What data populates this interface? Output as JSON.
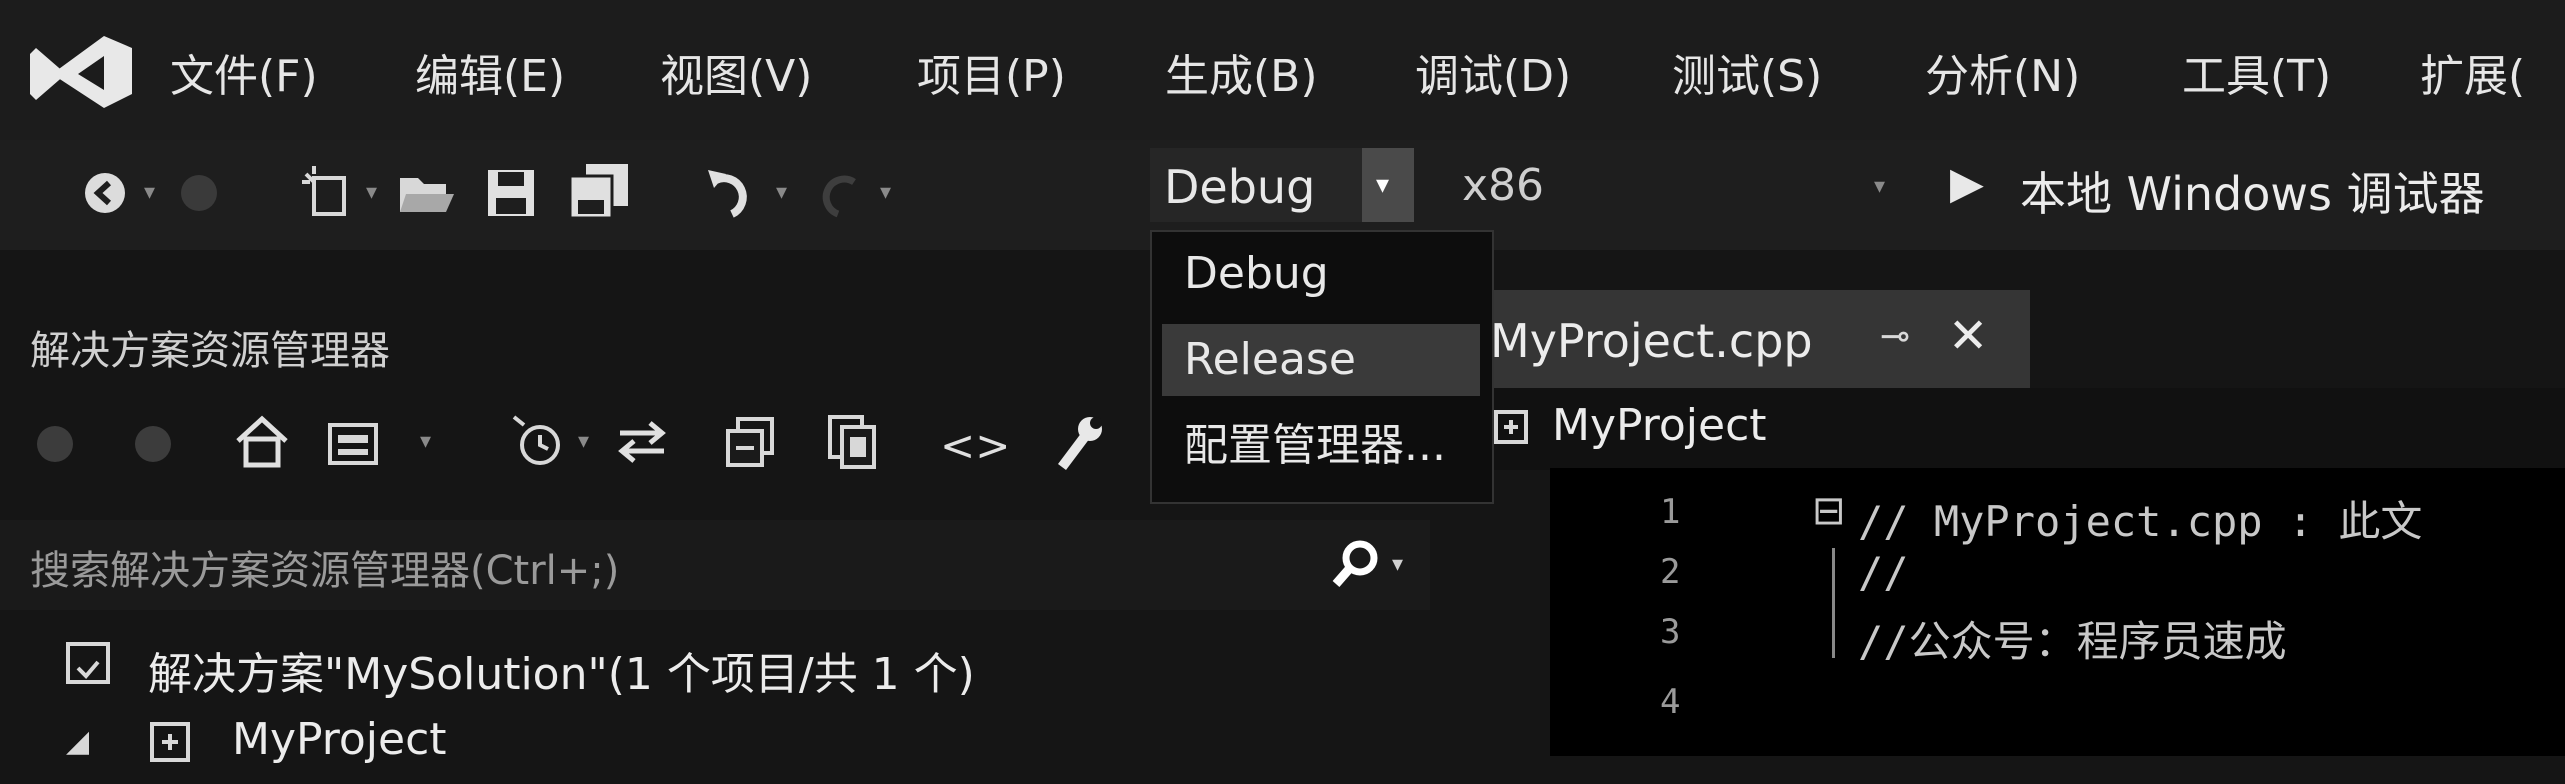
{
  "menu": {
    "items": [
      {
        "label": "文件(F)"
      },
      {
        "label": "编辑(E)"
      },
      {
        "label": "视图(V)"
      },
      {
        "label": "项目(P)"
      },
      {
        "label": "生成(B)"
      },
      {
        "label": "调试(D)"
      },
      {
        "label": "测试(S)"
      },
      {
        "label": "分析(N)"
      },
      {
        "label": "工具(T)"
      },
      {
        "label": "扩展("
      }
    ]
  },
  "toolbar": {
    "config_value": "Debug",
    "platform_value": "x86",
    "run_label": "本地 Windows 调试器"
  },
  "config_dropdown": {
    "options": [
      {
        "label": "Debug"
      },
      {
        "label": "Release"
      },
      {
        "label": "配置管理器..."
      }
    ]
  },
  "solution_explorer": {
    "title": "解决方案资源管理器",
    "search_placeholder": "搜索解决方案资源管理器(Ctrl+;)",
    "solution_label": "解决方案\"MySolution\"(1 个项目/共 1 个)",
    "project_label": "MyProject"
  },
  "editor": {
    "tab_label": "MyProject.cpp",
    "nav_scope": "MyProject",
    "lines": [
      {
        "num": "1",
        "text": "// MyProject.cpp : 此文"
      },
      {
        "num": "2",
        "text": "//"
      },
      {
        "num": "3",
        "text": "//公众号：程序员速成"
      },
      {
        "num": "4",
        "text": ""
      }
    ]
  },
  "colors": {
    "vs_logo": "#e8e8e8",
    "background": "#151515",
    "selection_highlight": "#3a3a3a"
  }
}
